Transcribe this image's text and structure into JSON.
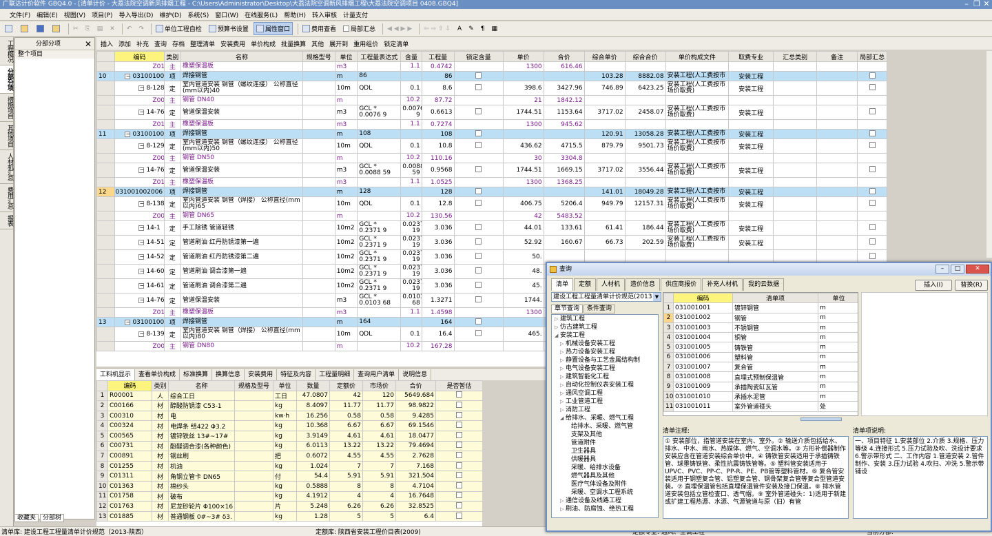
{
  "window": {
    "title": "广联达计价软件 GBQ4.0 - [清单计价 - 大荔法院空调新风排烟工程 - C:\\Users\\Administrator\\Desktop\\大荔法院空调新风排烟工程\\大荔法院空调项目 0408.GBQ4]",
    "min": "–",
    "restore": "❐",
    "close": "✕"
  },
  "menu": [
    "文件(F)",
    "编辑(E)",
    "视图(V)",
    "项目(P)",
    "导入导出(D)",
    "维护(D)",
    "系统(S)",
    "窗口(W)",
    "在线服务(L)",
    "帮助(H)",
    "转入审核",
    "计量支付"
  ],
  "toolbar": {
    "buttons": [
      "单位工程自检",
      "预算书设置",
      "属性窗口",
      "费用查看",
      "局部汇总"
    ]
  },
  "toolbar2": [
    "插入",
    "添加",
    "补充",
    "查询",
    "存档",
    "整理清单",
    "安装费用",
    "单价构成",
    "批量换算",
    "其他",
    "展开到",
    "重用组价",
    "锁定清单"
  ],
  "left_tabs": [
    "工程概况",
    "分部分项",
    "措施项目",
    "其他项目",
    "人材机汇总",
    "费用汇总",
    "报表"
  ],
  "nav": {
    "title": "分部分项",
    "close": "✕",
    "item": "整个项目",
    "tabs": [
      "收藏夹",
      "分部树"
    ]
  },
  "grid": {
    "headers": [
      "",
      "编码",
      "类别",
      "名称",
      "规格型号",
      "单位",
      "工程量表达式",
      "含量",
      "工程量",
      "锁定含量",
      "单价",
      "合价",
      "综合单价",
      "综合合价",
      "单价构成文件",
      "取费专业",
      "汇总类别",
      "备注",
      "局部汇总"
    ],
    "rows": [
      {
        "t": "m",
        "n": "",
        "code": "Z0166481",
        "cat": "主",
        "name": "橡塑保温板",
        "unit": "m3",
        "expr": "",
        "qty": "1.1",
        "amt": "0.4742",
        "price": "1300",
        "total": "616.46",
        "up": "",
        "ut": "",
        "file": "",
        "prof": ""
      },
      {
        "t": "b",
        "n": "10",
        "code": "031001002004",
        "cat": "项",
        "name": "焊接钢管",
        "unit": "m",
        "expr": "86",
        "qty": "",
        "amt": "86",
        "price": "",
        "total": "",
        "up": "103.28",
        "ut": "8882.08",
        "file": "安装工程(人工费按市",
        "prof": "安装工程"
      },
      {
        "t": "d",
        "n": "",
        "code": "8-128",
        "cat": "定",
        "name": "室内管道安装 钢管（螺纹连接） 公称直径(mm以内)40",
        "unit": "10m",
        "expr": "QDL",
        "qty": "0.1",
        "amt": "8.6",
        "price": "398.6",
        "total": "3427.96",
        "up": "746.89",
        "ut": "6423.25",
        "file": "安装工程(人工费按市场价取费)",
        "prof": "安装工程"
      },
      {
        "t": "m",
        "n": "",
        "code": "Z00927",
        "cat": "主",
        "name": "钢管 DN40",
        "unit": "m",
        "expr": "",
        "qty": "10.2",
        "amt": "87.72",
        "price": "21",
        "total": "1842.12",
        "up": "",
        "ut": "",
        "file": "",
        "prof": ""
      },
      {
        "t": "d",
        "n": "",
        "code": "14-760",
        "cat": "定",
        "name": "管道保温安装",
        "unit": "m3",
        "expr": "GCL * 0.0076 9",
        "qty": "0.0076 9",
        "amt": "0.6613",
        "price": "1744.51",
        "total": "1153.64",
        "up": "3717.02",
        "ut": "2458.07",
        "file": "安装工程(人工费按市场价取费)",
        "prof": "安装工程"
      },
      {
        "t": "m",
        "n": "",
        "code": "Z0166481",
        "cat": "主",
        "name": "橡塑保温板",
        "unit": "m3",
        "expr": "",
        "qty": "1.1",
        "amt": "0.7274",
        "price": "1300",
        "total": "945.62",
        "up": "",
        "ut": "",
        "file": "",
        "prof": ""
      },
      {
        "t": "b",
        "n": "11",
        "code": "031001002005",
        "cat": "项",
        "name": "焊接钢管",
        "unit": "m",
        "expr": "108",
        "qty": "",
        "amt": "108",
        "price": "",
        "total": "",
        "up": "120.91",
        "ut": "13058.28",
        "file": "安装工程(人工费按市",
        "prof": "安装工程"
      },
      {
        "t": "d",
        "n": "",
        "code": "8-129",
        "cat": "定",
        "name": "室内管道安装 钢管（螺纹连接） 公称直径(mm以内)50",
        "unit": "10m",
        "expr": "QDL",
        "qty": "0.1",
        "amt": "10.8",
        "price": "436.62",
        "total": "4715.5",
        "up": "879.79",
        "ut": "9501.73",
        "file": "安装工程(人工费按市场价取费)",
        "prof": "安装工程"
      },
      {
        "t": "m",
        "n": "",
        "code": "Z00928",
        "cat": "主",
        "name": "钢管 DN50",
        "unit": "m",
        "expr": "",
        "qty": "10.2",
        "amt": "110.16",
        "price": "30",
        "total": "3304.8",
        "up": "",
        "ut": "",
        "file": "",
        "prof": ""
      },
      {
        "t": "d",
        "n": "",
        "code": "14-760",
        "cat": "定",
        "name": "管道保温安装",
        "unit": "m3",
        "expr": "GCL * 0.0088 59",
        "qty": "0.0088 59",
        "amt": "0.9568",
        "price": "1744.51",
        "total": "1669.15",
        "up": "3717.02",
        "ut": "3556.44",
        "file": "安装工程(人工费按市场价取费)",
        "prof": "安装工程"
      },
      {
        "t": "m",
        "n": "",
        "code": "Z0166481",
        "cat": "主",
        "name": "橡塑保温板",
        "unit": "m3",
        "expr": "",
        "qty": "1.1",
        "amt": "1.0525",
        "price": "1300",
        "total": "1368.25",
        "up": "",
        "ut": "",
        "file": "",
        "prof": ""
      },
      {
        "t": "bs",
        "n": "12",
        "code": "031001002006",
        "cat": "项",
        "name": "焊接钢管",
        "unit": "m",
        "expr": "128",
        "qty": "",
        "amt": "128",
        "price": "",
        "total": "",
        "up": "141.01",
        "ut": "18049.28",
        "file": "安装工程(人工费按市",
        "prof": "安装工程"
      },
      {
        "t": "d",
        "n": "",
        "code": "8-138",
        "cat": "定",
        "name": "室内管道安装 钢管（焊接） 公称直径(mm以内)65",
        "unit": "10m",
        "expr": "QDL",
        "qty": "0.1",
        "amt": "12.8",
        "price": "406.75",
        "total": "5206.4",
        "up": "949.79",
        "ut": "12157.31",
        "file": "安装工程(人工费按市场价取费)",
        "prof": "安装工程"
      },
      {
        "t": "m",
        "n": "",
        "code": "Z00929",
        "cat": "主",
        "name": "钢管 DN65",
        "unit": "m",
        "expr": "",
        "qty": "10.2",
        "amt": "130.56",
        "price": "42",
        "total": "5483.52",
        "up": "",
        "ut": "",
        "file": "",
        "prof": ""
      },
      {
        "t": "d",
        "n": "",
        "code": "14-1",
        "cat": "定",
        "name": "手工除锈 管道轻锈",
        "unit": "10m2",
        "expr": "GCL * 0.2371 9",
        "qty": "0.0237 19",
        "amt": "3.036",
        "price": "44.01",
        "total": "133.61",
        "up": "61.41",
        "ut": "186.44",
        "file": "安装工程(人工费按市场价取费)",
        "prof": "安装工程"
      },
      {
        "t": "d",
        "n": "",
        "code": "14-51",
        "cat": "定",
        "name": "管道刷油 红丹防锈漆第一遍",
        "unit": "10m2",
        "expr": "GCL * 0.2371 9",
        "qty": "0.0237 19",
        "amt": "3.036",
        "price": "52.92",
        "total": "160.67",
        "up": "66.73",
        "ut": "202.59",
        "file": "安装工程(人工费按市场价取费)",
        "prof": "安装工程"
      },
      {
        "t": "d",
        "n": "",
        "code": "14-52",
        "cat": "定",
        "name": "管道刷油 红丹防锈漆第二遍",
        "unit": "10m2",
        "expr": "GCL * 0.2371 9",
        "qty": "0.0237 19",
        "amt": "3.036",
        "price": "50.",
        "total": "",
        "up": "",
        "ut": "",
        "file": "",
        "prof": ""
      },
      {
        "t": "d",
        "n": "",
        "code": "14-60",
        "cat": "定",
        "name": "管道刷油 调合漆第一遍",
        "unit": "10m2",
        "expr": "GCL * 0.2371 9",
        "qty": "0.0237 19",
        "amt": "3.036",
        "price": "48.",
        "total": "",
        "up": "",
        "ut": "",
        "file": "",
        "prof": ""
      },
      {
        "t": "d",
        "n": "",
        "code": "14-61",
        "cat": "定",
        "name": "管道刷油 调合漆第二遍",
        "unit": "10m2",
        "expr": "GCL * 0.2371 9",
        "qty": "0.0237 19",
        "amt": "3.036",
        "price": "45.",
        "total": "",
        "up": "",
        "ut": "",
        "file": "",
        "prof": ""
      },
      {
        "t": "d",
        "n": "",
        "code": "14-760",
        "cat": "定",
        "name": "管道保温安装",
        "unit": "m3",
        "expr": "GCL * 0.0103 68",
        "qty": "0.0103 68",
        "amt": "1.3271",
        "price": "1744.",
        "total": "",
        "up": "",
        "ut": "",
        "file": "",
        "prof": ""
      },
      {
        "t": "m",
        "n": "",
        "code": "Z0166481",
        "cat": "主",
        "name": "橡塑保温板",
        "unit": "m3",
        "expr": "",
        "qty": "1.1",
        "amt": "1.4598",
        "price": "1300",
        "total": "",
        "up": "",
        "ut": "",
        "file": "",
        "prof": ""
      },
      {
        "t": "b",
        "n": "13",
        "code": "031001002007",
        "cat": "项",
        "name": "焊接钢管",
        "unit": "m",
        "expr": "164",
        "qty": "",
        "amt": "164",
        "price": "",
        "total": "",
        "up": "",
        "ut": "",
        "file": "",
        "prof": ""
      },
      {
        "t": "d",
        "n": "",
        "code": "8-139",
        "cat": "定",
        "name": "室内管道安装 钢管（焊接） 公称直径(mm以内)80",
        "unit": "10m",
        "expr": "QDL",
        "qty": "0.1",
        "amt": "16.4",
        "price": "465.",
        "total": "",
        "up": "",
        "ut": "",
        "file": "",
        "prof": ""
      },
      {
        "t": "m",
        "n": "",
        "code": "Z00930",
        "cat": "主",
        "name": "钢管 DN80",
        "unit": "m",
        "expr": "",
        "qty": "10.2",
        "amt": "167.28",
        "price": "",
        "total": "",
        "up": "",
        "ut": "",
        "file": "",
        "prof": ""
      }
    ]
  },
  "bottom_tabs": [
    "工料机显示",
    "查看单价构成",
    "标准换算",
    "换算信息",
    "安装费用",
    "特征及内容",
    "工程量明细",
    "查询用户清单",
    "说明信息"
  ],
  "materials": {
    "headers": [
      "",
      "编码",
      "类别",
      "名称",
      "规格及型号",
      "单位",
      "数量",
      "定额价",
      "市场价",
      "合价",
      "是否暂估"
    ],
    "rows": [
      [
        "1",
        "R00001",
        "人",
        "综合工日",
        "",
        "工日",
        "47.0807",
        "42",
        "120",
        "5649.684"
      ],
      [
        "2",
        "C00166",
        "材",
        "醇酸防锈漆 C53-1",
        "",
        "kg",
        "8.4097",
        "11.77",
        "11.77",
        "98.9822"
      ],
      [
        "3",
        "C00310",
        "材",
        "电",
        "",
        "kw·h",
        "16.256",
        "0.58",
        "0.58",
        "9.4285"
      ],
      [
        "4",
        "C00324",
        "材",
        "电焊条 结422 Φ3.2",
        "",
        "kg",
        "10.368",
        "6.67",
        "6.67",
        "69.1546"
      ],
      [
        "5",
        "C00565",
        "材",
        "镀锌铁丝 13#~17#",
        "",
        "kg",
        "3.9149",
        "4.61",
        "4.61",
        "18.0477"
      ],
      [
        "6",
        "C00731",
        "材",
        "酚醛调合漆(各种颜色)",
        "",
        "kg",
        "6.0113",
        "13.22",
        "13.22",
        "79.4694"
      ],
      [
        "7",
        "C00891",
        "材",
        "钢丝刷",
        "",
        "把",
        "0.6072",
        "4.55",
        "4.55",
        "2.7628"
      ],
      [
        "8",
        "C01255",
        "材",
        "机油",
        "",
        "kg",
        "1.024",
        "7",
        "7",
        "7.168"
      ],
      [
        "9",
        "C01311",
        "材",
        "角钢立管卡 DN65",
        "",
        "付",
        "54.4",
        "5.91",
        "5.91",
        "321.504"
      ],
      [
        "10",
        "C01363",
        "材",
        "棉纱头",
        "",
        "kg",
        "0.5888",
        "8",
        "8",
        "4.7104"
      ],
      [
        "11",
        "C01758",
        "材",
        "破布",
        "",
        "kg",
        "4.1912",
        "4",
        "4",
        "16.7648"
      ],
      [
        "12",
        "C01763",
        "材",
        "尼龙砂轮片 Φ100×16",
        "",
        "片",
        "5.248",
        "6.26",
        "6.26",
        "32.8525"
      ],
      [
        "13",
        "C01885",
        "材",
        "普通钢板 0#~3# δ3.",
        "",
        "kg",
        "1.28",
        "5",
        "5",
        "6.4"
      ]
    ]
  },
  "status": {
    "list_lib": "清单库: 建设工程工程量清单计价规范（2013-陕西）",
    "quota_lib": "定额库: 陕西省安装工程价目表(2009)",
    "prof": "定额专业: 通风、空调工程",
    "sub": "当前分部:"
  },
  "dialog": {
    "title": "查询",
    "tabs": [
      "清单",
      "定额",
      "人材机",
      "造价信息",
      "供应商报价",
      "补充人材机",
      "我的云数据"
    ],
    "insert": "插入(I)",
    "replace": "替换(R)",
    "combo": "建设工程工程量清单计价规范(2013",
    "subtabs": [
      "章节查询",
      "条件查询"
    ],
    "tree": [
      {
        "i": 0,
        "tw": "▷",
        "t": "建筑工程"
      },
      {
        "i": 0,
        "tw": "▷",
        "t": "仿古建筑工程"
      },
      {
        "i": 0,
        "tw": "◢",
        "t": "安装工程"
      },
      {
        "i": 1,
        "tw": "▷",
        "t": "机械设备安装工程"
      },
      {
        "i": 1,
        "tw": "▷",
        "t": "热力设备安装工程"
      },
      {
        "i": 1,
        "tw": "▷",
        "t": "静置设备与工艺金属结构制"
      },
      {
        "i": 1,
        "tw": "▷",
        "t": "电气设备安装工程"
      },
      {
        "i": 1,
        "tw": "▷",
        "t": "建筑智能化工程"
      },
      {
        "i": 1,
        "tw": "▷",
        "t": "自动化控制仪表安装工程"
      },
      {
        "i": 1,
        "tw": "▷",
        "t": "通风空调工程"
      },
      {
        "i": 1,
        "tw": "▷",
        "t": "工业管道工程"
      },
      {
        "i": 1,
        "tw": "▷",
        "t": "消防工程"
      },
      {
        "i": 1,
        "tw": "◢",
        "t": "给排水、采暖、燃气工程"
      },
      {
        "i": 2,
        "tw": "",
        "t": "给排水、采暖、燃气管"
      },
      {
        "i": 2,
        "tw": "",
        "t": "支架及其他"
      },
      {
        "i": 2,
        "tw": "",
        "t": "管道附件"
      },
      {
        "i": 2,
        "tw": "",
        "t": "卫生器具"
      },
      {
        "i": 2,
        "tw": "",
        "t": "供暖器具"
      },
      {
        "i": 2,
        "tw": "",
        "t": "采暖、给排水设备"
      },
      {
        "i": 2,
        "tw": "",
        "t": "燃气器具及其他"
      },
      {
        "i": 2,
        "tw": "",
        "t": "医疗气体设备及附件"
      },
      {
        "i": 2,
        "tw": "",
        "t": "采暖、空调水工程系统"
      },
      {
        "i": 1,
        "tw": "▷",
        "t": "通信设备及线路工程"
      },
      {
        "i": 1,
        "tw": "▷",
        "t": "刷油、防腐蚀、绝热工程"
      }
    ],
    "list_headers": [
      "",
      "编码",
      "清单项",
      "单位"
    ],
    "list": [
      [
        "1",
        "031001001",
        "镀锌钢管",
        "m"
      ],
      [
        "2",
        "031001002",
        "钢管",
        "m"
      ],
      [
        "3",
        "031001003",
        "不锈钢管",
        "m"
      ],
      [
        "4",
        "031001004",
        "铜管",
        "m"
      ],
      [
        "5",
        "031001005",
        "铸铁管",
        "m"
      ],
      [
        "6",
        "031001006",
        "塑料管",
        "m"
      ],
      [
        "7",
        "031001007",
        "复合管",
        "m"
      ],
      [
        "8",
        "031001008",
        "直埋式预制保温管",
        "m"
      ],
      [
        "9",
        "031001009",
        "承插陶瓷缸瓦管",
        "m"
      ],
      [
        "10",
        "031001010",
        "承插水泥管",
        "m"
      ],
      [
        "11",
        "031001011",
        "室外管道碰头",
        "处"
      ]
    ],
    "notes_label": "清单注释:",
    "notes": "① 安装部位，指管道安装在室内、室外。② 输送介质包括给水、排水、中水、雨水、热媒体、燃气、空调水等。③ 方形补偿器制作安装应含在管道安装综合单价中。④ 铸铁管安装适用于承插铸铁管、球墨铸铁管、柔性抗震铸铁管等。⑤ 塑料管安装适用于UPVC、PVC、PP-C、PP-R、PE、PB管等塑料管材。⑥ 复合管安装适用于钢塑复合管、铝塑复合管、钢骨架复合管等复合型管道安装。⑦ 直埋保温管包括直埋保温管件安装及接口保温。⑧ 排水管道安装包括立管检查口、透气帽。⑨ 室外管道碰头：1)适用于新建或扩建工程热源、水源、气源管道与原（旧）有管",
    "desc_label": "清单项说明:",
    "desc": "一、项目特征 1.安装部位 2.介质 3.规格、压力等级 4.连接形式 5.压力试验及吹、洗设计要求 6.警示带形式 二、工作内容 1.管道安装 2.管件制作、安装 3.压力试验 4.吹扫、冲洗 5.警示带铺设"
  }
}
